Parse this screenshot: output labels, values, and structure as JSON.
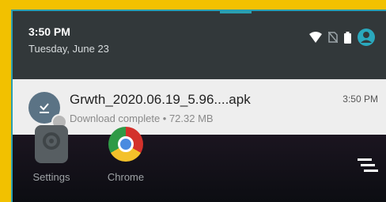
{
  "status_bar": {
    "time": "3:50 PM",
    "date": "Tuesday, June 23",
    "icons": [
      "wifi-icon",
      "no-sim-icon",
      "battery-icon",
      "account-icon"
    ]
  },
  "notification": {
    "icon": "download-complete-icon",
    "title": "Grwth_2020.06.19_5.96....apk",
    "subtitle": "Download complete • 72.32 MB",
    "time": "3:50 PM"
  },
  "home_apps": [
    {
      "label": "Settings",
      "icon": "settings-icon"
    },
    {
      "label": "Chrome",
      "icon": "chrome-icon"
    }
  ],
  "nav": {
    "icon": "sort-menu-icon"
  },
  "colors": {
    "outer_frame": "#f2c100",
    "accent": "#2a9fb0",
    "notification_bg": "#eeeeee",
    "shade_bg": "#32383a"
  }
}
